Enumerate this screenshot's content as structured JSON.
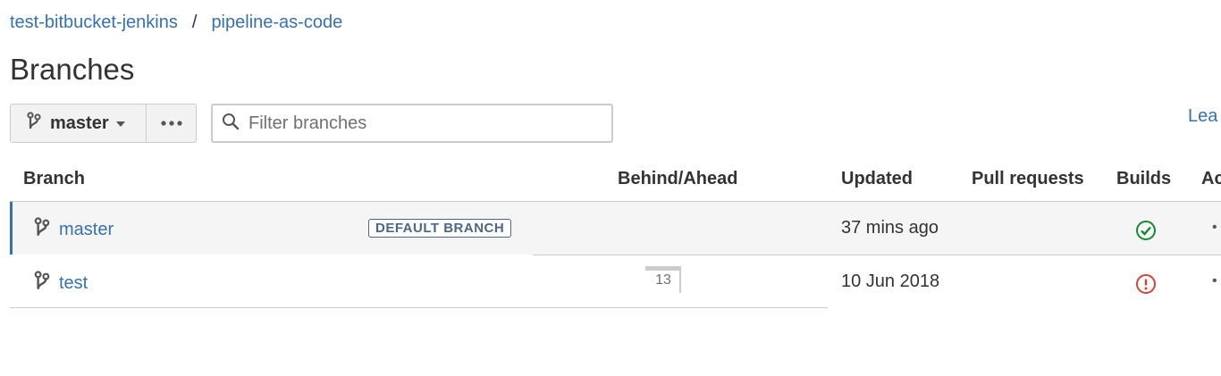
{
  "breadcrumb": {
    "project": "test-bitbucket-jenkins",
    "separator": "/",
    "repo": "pipeline-as-code"
  },
  "page_title": "Branches",
  "toolbar": {
    "branch_selector_label": "master",
    "branch_icon": "branch-icon",
    "more_icon": "ellipsis-icon",
    "filter_placeholder": "Filter branches",
    "learn_more_label": "Lea"
  },
  "table": {
    "headers": {
      "branch": "Branch",
      "behind_ahead": "Behind/Ahead",
      "updated": "Updated",
      "pull_requests": "Pull requests",
      "builds": "Builds",
      "actions": "Ac"
    },
    "rows": [
      {
        "name": "master",
        "lozenge": "DEFAULT BRANCH",
        "ahead": "",
        "updated": "37 mins ago",
        "build_status": "success",
        "build_icon": "check-circle-icon",
        "build_color": "#14892c",
        "actions": "•"
      },
      {
        "name": "test",
        "lozenge": "",
        "ahead": "13",
        "updated": "10 Jun 2018",
        "build_status": "failed",
        "build_icon": "error-circle-icon",
        "build_color": "#d04437",
        "actions": "•"
      }
    ]
  },
  "colors": {
    "link": "#3572b0",
    "selected_row_bg": "#f5f5f5",
    "selected_row_accent": "#3572b0"
  }
}
